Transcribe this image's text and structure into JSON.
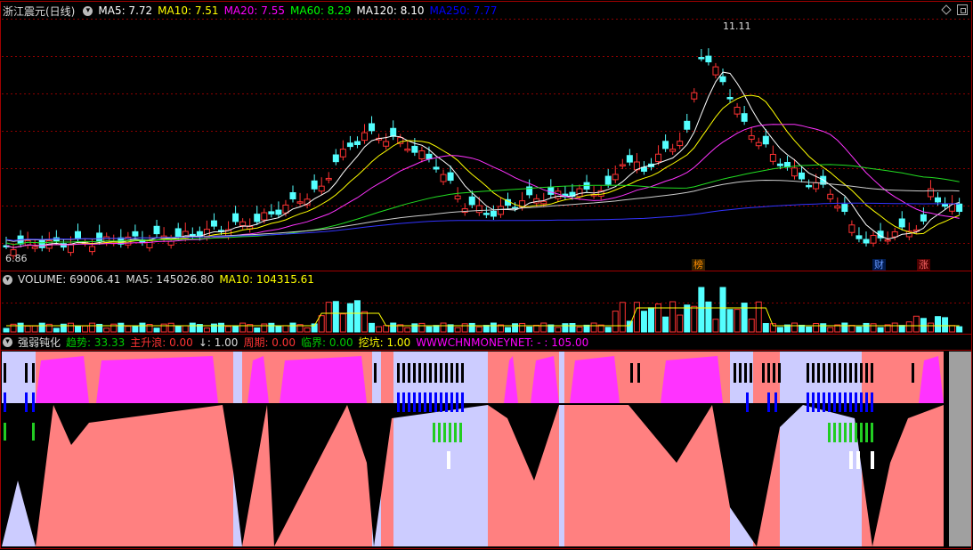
{
  "stock": {
    "name": "浙江震元(日线)"
  },
  "ma_legend": [
    {
      "label": "MA5: 7.72",
      "color": "#ffffff"
    },
    {
      "label": "MA10: 7.51",
      "color": "#ffff00"
    },
    {
      "label": "MA20: 7.55",
      "color": "#ff00ff"
    },
    {
      "label": "MA60: 8.29",
      "color": "#00ff00"
    },
    {
      "label": "MA120: 8.10",
      "color": "#ffffff"
    },
    {
      "label": "MA250: 7.77",
      "color": "#0000ff"
    }
  ],
  "price_high_label": "11.11",
  "price_low_label": "6.86",
  "events": [
    {
      "text": "榜",
      "color": "#ff8c00"
    },
    {
      "text": "财",
      "color": "#3366ff"
    },
    {
      "text": "涨",
      "color": "#ff3333"
    }
  ],
  "volume_legend": [
    {
      "label": "VOLUME: 69006.41",
      "color": "#dddddd"
    },
    {
      "label": "MA5: 145026.80",
      "color": "#dddddd"
    },
    {
      "label": "MA10: 104315.61",
      "color": "#ffff00"
    }
  ],
  "indicator_legend": [
    {
      "label": "强弱钝化",
      "color": "#dddddd"
    },
    {
      "label": "趋势: 33.33",
      "color": "#00cc00"
    },
    {
      "label": "主升浪: 0.00",
      "color": "#ff3333"
    },
    {
      "label": "↓: 1.00",
      "color": "#dddddd"
    },
    {
      "label": "周期: 0.00",
      "color": "#ff3333"
    },
    {
      "label": "临界: 0.00",
      "color": "#00cc00"
    },
    {
      "label": "挖坑: 1.00",
      "color": "#ffff00"
    },
    {
      "label": "WWWCHNMONEYNET: - : 105.00",
      "color": "#ff00ff"
    }
  ],
  "colors": {
    "up": "#ff3333",
    "down": "#54ffff",
    "grid": "#8b0000",
    "border": "#a00000",
    "magenta": "#ff33ff",
    "salmon": "#ff8080",
    "lavender": "#ccccff",
    "blue": "#0000ff",
    "green": "#22cc22"
  },
  "icons": [
    "settings-circle-icon",
    "diamond-icon",
    "window-restore-icon"
  ]
}
